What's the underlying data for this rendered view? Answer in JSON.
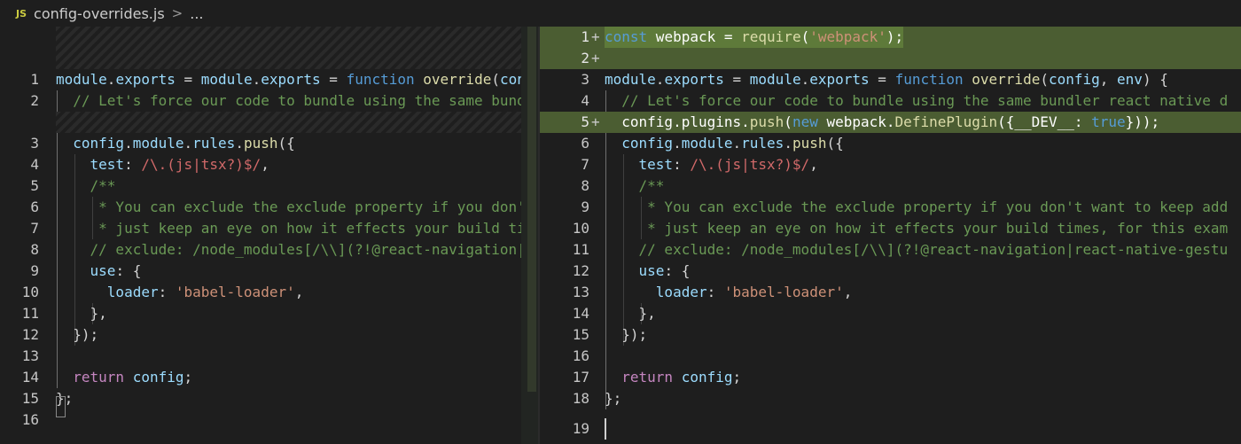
{
  "breadcrumb": {
    "icon": "JS",
    "file": "config-overrides.js",
    "separator": ">",
    "more": "..."
  },
  "left": {
    "lines": [
      {
        "num": "1",
        "text": "module.exports = module.exports = function override(con"
      },
      {
        "num": "2",
        "text": "  // Let's force our code to bundle using the same bund"
      },
      {
        "num": "3",
        "text": "  config.module.rules.push({"
      },
      {
        "num": "4",
        "text": "    test: /\\.(js|tsx?)$/,"
      },
      {
        "num": "5",
        "text": "    /**"
      },
      {
        "num": "6",
        "text": "     * You can exclude the exclude property if you don'"
      },
      {
        "num": "7",
        "text": "     * just keep an eye on how it effects your build ti"
      },
      {
        "num": "8",
        "text": "    // exclude: /node_modules[/\\\\](?!@react-navigation|"
      },
      {
        "num": "9",
        "text": "    use: {"
      },
      {
        "num": "10",
        "text": "      loader: 'babel-loader',"
      },
      {
        "num": "11",
        "text": "    },"
      },
      {
        "num": "12",
        "text": "  });"
      },
      {
        "num": "13",
        "text": ""
      },
      {
        "num": "14",
        "text": "  return config;"
      },
      {
        "num": "15",
        "text": "};"
      },
      {
        "num": "16",
        "text": ""
      }
    ]
  },
  "right": {
    "lines": [
      {
        "num": "1",
        "mark": "+",
        "text": "const webpack = require('webpack');"
      },
      {
        "num": "2",
        "mark": "+",
        "text": ""
      },
      {
        "num": "3",
        "mark": "",
        "text": "module.exports = module.exports = function override(config, env) {"
      },
      {
        "num": "4",
        "mark": "",
        "text": "  // Let's force our code to bundle using the same bundler react native d"
      },
      {
        "num": "5",
        "mark": "+",
        "text": "  config.plugins.push(new webpack.DefinePlugin({__DEV__: true}));"
      },
      {
        "num": "6",
        "mark": "",
        "text": "  config.module.rules.push({"
      },
      {
        "num": "7",
        "mark": "",
        "text": "    test: /\\.(js|tsx?)$/,"
      },
      {
        "num": "8",
        "mark": "",
        "text": "    /**"
      },
      {
        "num": "9",
        "mark": "",
        "text": "     * You can exclude the exclude property if you don't want to keep add"
      },
      {
        "num": "10",
        "mark": "",
        "text": "     * just keep an eye on how it effects your build times, for this exam"
      },
      {
        "num": "11",
        "mark": "",
        "text": "    // exclude: /node_modules[/\\\\](?!@react-navigation|react-native-gestu"
      },
      {
        "num": "12",
        "mark": "",
        "text": "    use: {"
      },
      {
        "num": "13",
        "mark": "",
        "text": "      loader: 'babel-loader',"
      },
      {
        "num": "14",
        "mark": "",
        "text": "    },"
      },
      {
        "num": "15",
        "mark": "",
        "text": "  });"
      },
      {
        "num": "16",
        "mark": "",
        "text": ""
      },
      {
        "num": "17",
        "mark": "",
        "text": "  return config;"
      },
      {
        "num": "18",
        "mark": "",
        "text": "};"
      },
      {
        "num": "19",
        "mark": "",
        "text": ""
      }
    ]
  },
  "colors": {
    "added_line_bg": "#4b5d32",
    "editor_bg": "#1e1e1e",
    "keyword": "#569cd6",
    "function": "#dcdcaa",
    "string": "#ce9178",
    "comment": "#6a9955"
  }
}
